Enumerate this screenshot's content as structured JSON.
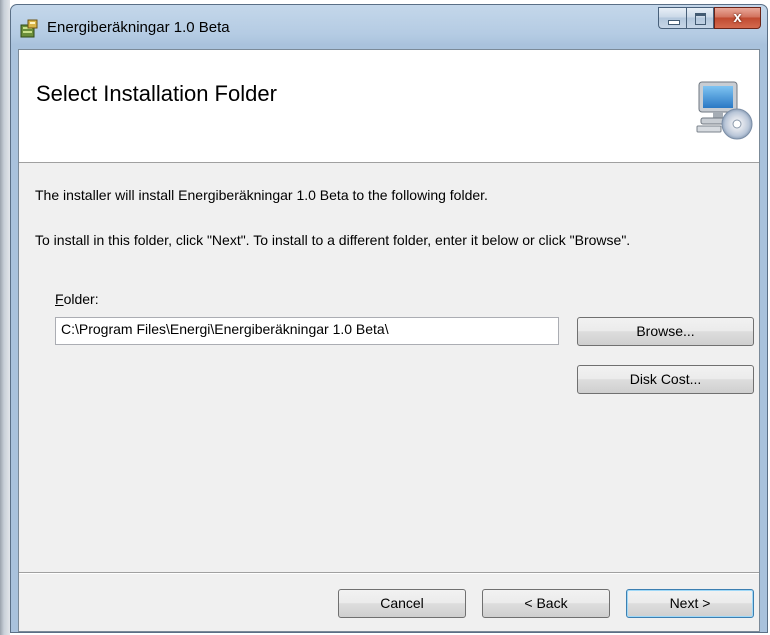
{
  "window": {
    "title": "Energiberäkningar 1.0 Beta",
    "close_glyph": "x"
  },
  "banner": {
    "title": "Select Installation Folder",
    "icon": "computer-cd-icon"
  },
  "body": {
    "text1": "The installer will install Energiberäkningar 1.0 Beta to the following folder.",
    "text2": "To install in this folder, click \"Next\". To install to a different folder, enter it below or click \"Browse\"."
  },
  "folder": {
    "label_accel": "F",
    "label_rest": "older:",
    "value": "C:\\Program Files\\Energi\\Energiberäkningar 1.0 Beta\\"
  },
  "buttons": {
    "browse": "Browse...",
    "disk_cost": "Disk Cost...",
    "cancel": "Cancel",
    "back": "< Back",
    "next": "Next >"
  },
  "colors": {
    "titlebar": "#b4cbe3",
    "close_button": "#c04a30",
    "default_button_border": "#3c7fb1"
  }
}
